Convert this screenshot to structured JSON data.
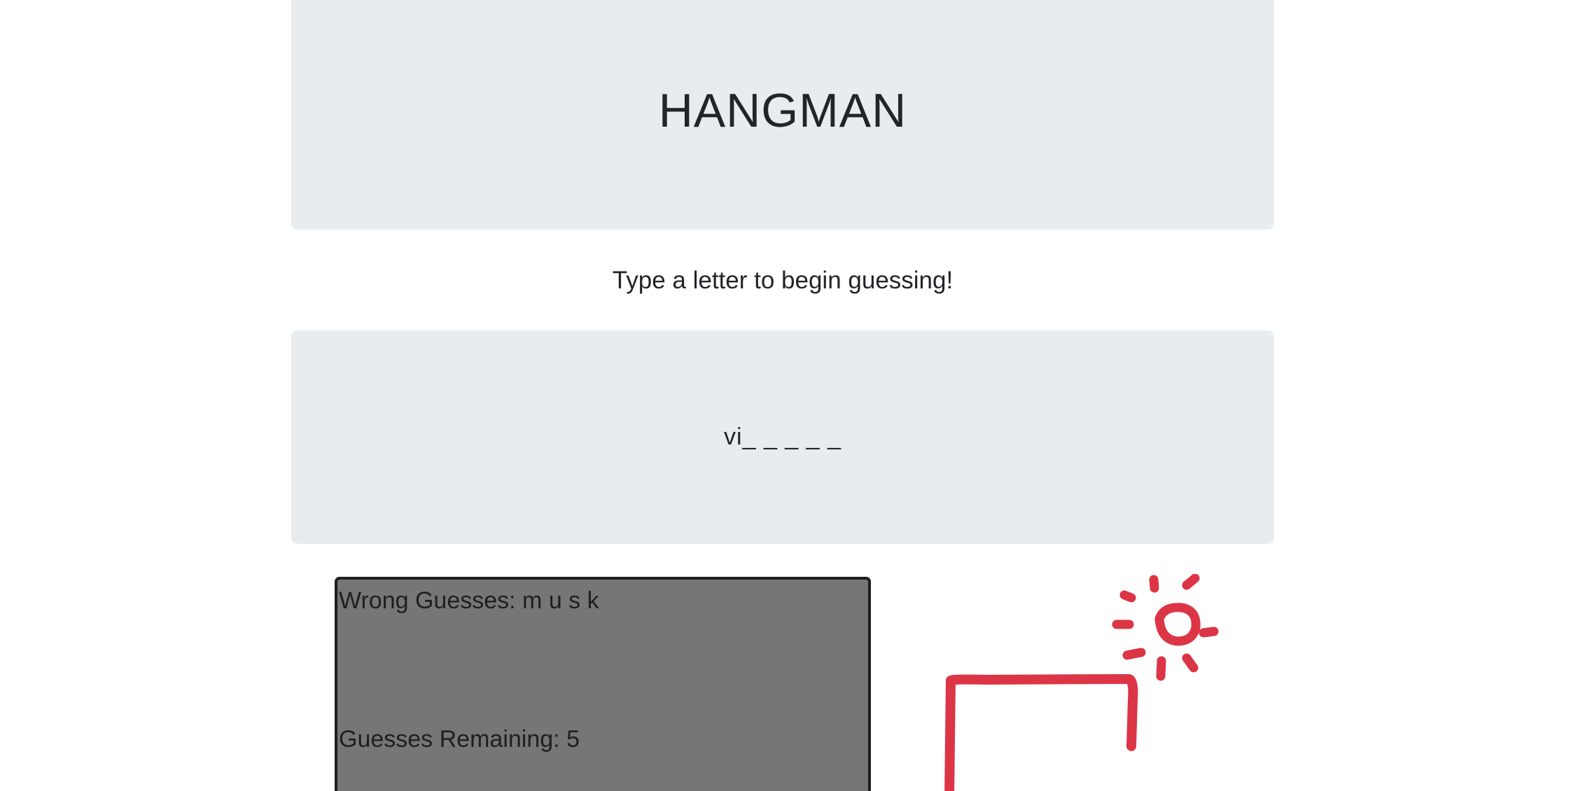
{
  "header": {
    "title": "HANGMAN"
  },
  "instructions": "Type a letter to begin guessing!",
  "word": {
    "display": "vi_ _ _ _ _"
  },
  "stats": {
    "wrong_guesses_label": "Wrong Guesses:",
    "wrong_guesses": "m u s k",
    "remaining_label": "Guesses Remaining:",
    "remaining": "5"
  },
  "drawing": {
    "icon": "hangman-gallows-with-sun",
    "color": "#dc3545"
  },
  "colors": {
    "panel_bg": "#e9ecef",
    "stats_bg": "#767676",
    "text": "#212529"
  }
}
